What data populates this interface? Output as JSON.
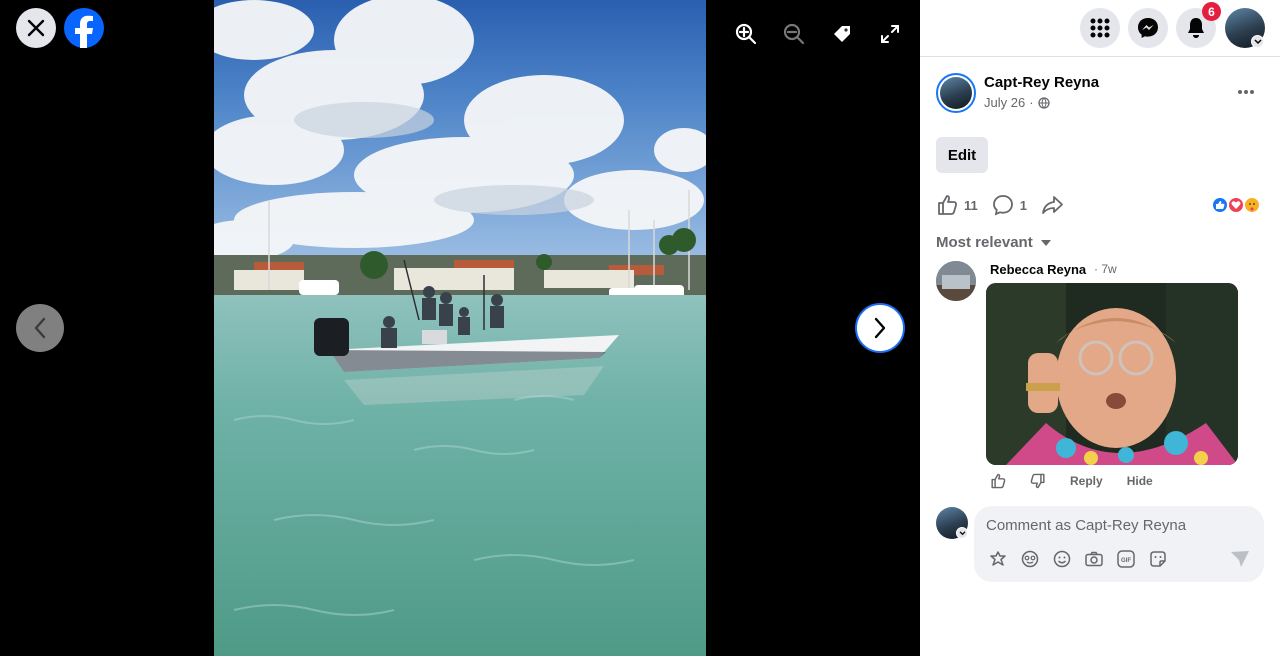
{
  "viewer": {
    "close_label": "Close",
    "logo": "facebook-logo",
    "tools": [
      "zoom-in-icon",
      "zoom-out-icon",
      "tag-icon",
      "fullscreen-icon"
    ]
  },
  "topbar": {
    "icons": [
      "menu-grid-icon",
      "messenger-icon",
      "notifications-icon"
    ],
    "notification_count": "6"
  },
  "post": {
    "author": "Capt-Rey Reyna",
    "date": "July 26",
    "separator": "·",
    "privacy": "globe-icon",
    "edit_label": "Edit",
    "likes": "11",
    "comments": "1",
    "reactions": [
      "like",
      "love",
      "care"
    ]
  },
  "comments": {
    "sort_label": "Most relevant",
    "items": [
      {
        "name": "Rebecca Reyna",
        "time": "· 7w",
        "reply_label": "Reply",
        "hide_label": "Hide"
      }
    ],
    "input_placeholder": "Comment as Capt-Rey Reyna"
  },
  "colors": {
    "brand": "#0866ff",
    "badge": "#e41e3f",
    "secondary_text": "#65676b"
  }
}
